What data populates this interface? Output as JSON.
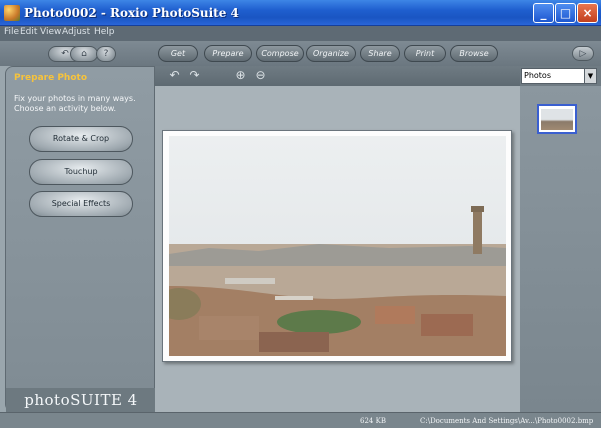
{
  "window": {
    "title": "Photo0002 - Roxio PhotoSuite 4"
  },
  "menu": {
    "file": "File",
    "edit": "Edit",
    "view": "View",
    "adjust": "Adjust",
    "help": "Help"
  },
  "toolbar": {
    "get": "Get",
    "prepare": "Prepare",
    "compose": "Compose",
    "organize": "Organize",
    "share": "Share",
    "print": "Print",
    "browse": "Browse"
  },
  "left_panel": {
    "title": "Prepare Photo",
    "description": "Fix your photos in many ways. Choose an activity below.",
    "buttons": [
      "Rotate & Crop",
      "Touchup",
      "Special Effects"
    ],
    "brand": "photoSUITE 4"
  },
  "right_panel": {
    "selected_value": "Photos"
  },
  "status": {
    "size": "624 KB",
    "path": "C:\\Documents And Settings\\Av...\\Photo0002.bmp"
  },
  "icons": {
    "undo": "undo-icon",
    "redo": "redo-icon",
    "zoom_in": "zoom-in-icon",
    "zoom_out": "zoom-out-icon",
    "back": "back-arrow-icon",
    "home": "home-icon",
    "help": "help-icon",
    "forward": "forward-icon"
  },
  "colors": {
    "title_bar": "#1f5fcf",
    "panel_title": "#f6c33c",
    "close_button": "#c2401e"
  }
}
